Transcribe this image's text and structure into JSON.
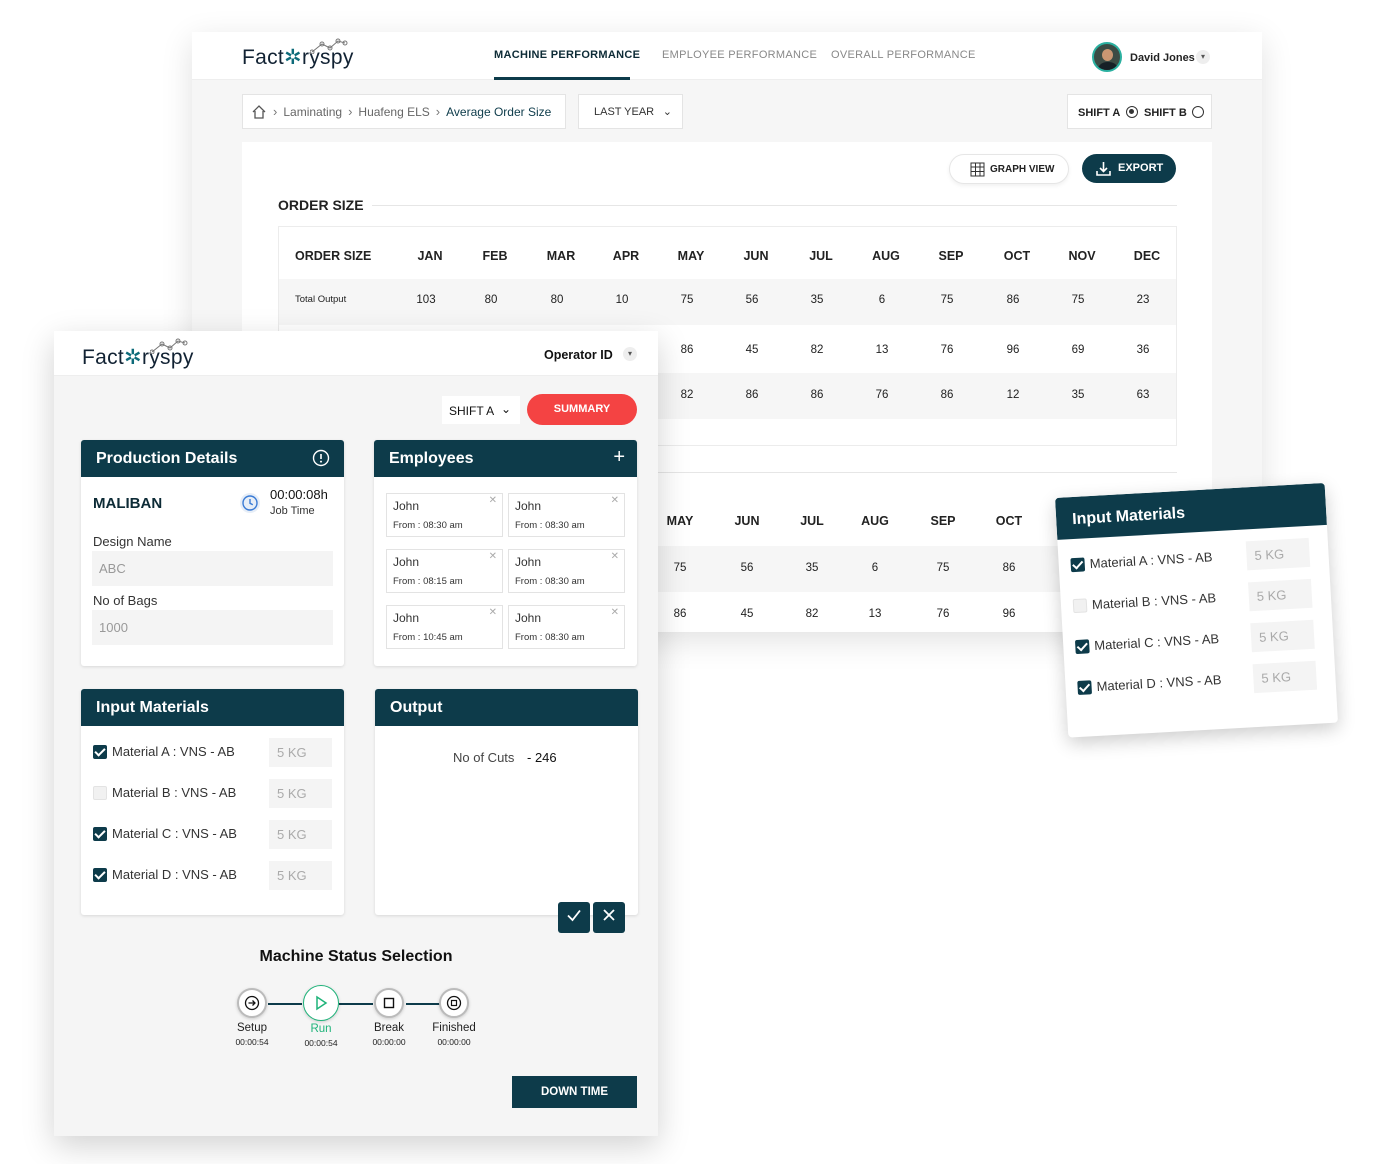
{
  "dashboard": {
    "logo": {
      "pre": "Fact",
      "mid": "ry",
      "post": "spy"
    },
    "nav": {
      "tabs": [
        "MACHINE PERFORMANCE",
        "EMPLOYEE PERFORMANCE",
        "OVERALL PERFORMANCE"
      ],
      "active_index": 0
    },
    "user": {
      "name": "David Jones"
    },
    "breadcrumb": [
      "Laminating",
      "Huafeng ELS",
      "Average Order Size"
    ],
    "period_select": "LAST YEAR",
    "shift": {
      "a": "SHIFT A",
      "b": "SHIFT B",
      "selected": "SHIFT A"
    },
    "buttons": {
      "graph_view": "GRAPH VIEW",
      "export": "EXPORT"
    },
    "section_title": "ORDER SIZE",
    "table": {
      "header_label": "ORDER SIZE",
      "months": [
        "JAN",
        "FEB",
        "MAR",
        "APR",
        "MAY",
        "JUN",
        "JUL",
        "AUG",
        "SEP",
        "OCT",
        "NOV",
        "DEC"
      ],
      "row_label": "Total Output",
      "row1": [
        "103",
        "80",
        "80",
        "10",
        "75",
        "56",
        "35",
        "6",
        "75",
        "86",
        "75",
        "23"
      ],
      "row2": [
        "86",
        "45",
        "82",
        "13",
        "76",
        "96",
        "69",
        "36"
      ],
      "row3": [
        "82",
        "86",
        "86",
        "76",
        "86",
        "12",
        "35",
        "63"
      ]
    },
    "table2": {
      "months": [
        "MAY",
        "JUN",
        "JUL",
        "AUG",
        "SEP",
        "OCT"
      ],
      "row1": [
        "75",
        "56",
        "35",
        "6",
        "75",
        "86"
      ],
      "row2": [
        "86",
        "45",
        "82",
        "13",
        "76",
        "96"
      ]
    }
  },
  "operator": {
    "logo": {
      "pre": "Fact",
      "mid": "ry",
      "post": "spy"
    },
    "operator_id_label": "Operator ID",
    "shift_select": "SHIFT A",
    "summary_button": "SUMMARY",
    "production": {
      "title": "Production Details",
      "job": "MALIBAN",
      "time": "00:00:08h",
      "time_label": "Job Time",
      "design_name_label": "Design Name",
      "design_name_value": "ABC",
      "bags_label": "No of Bags",
      "bags_value": "1000"
    },
    "employees": {
      "title": "Employees",
      "list": [
        {
          "name": "John",
          "from": "From : 08:30 am"
        },
        {
          "name": "John",
          "from": "From : 08:30 am"
        },
        {
          "name": "John",
          "from": "From : 08:15 am"
        },
        {
          "name": "John",
          "from": "From : 08:30 am"
        },
        {
          "name": "John",
          "from": "From : 10:45 am"
        },
        {
          "name": "John",
          "from": "From : 08:30 am"
        }
      ]
    },
    "input_materials": {
      "title": "Input Materials",
      "items": [
        {
          "label": "Material A :  VNS - AB",
          "qty": "5 KG",
          "checked": true
        },
        {
          "label": "Material B :  VNS - AB",
          "qty": "5 KG",
          "checked": false
        },
        {
          "label": "Material C :  VNS - AB",
          "qty": "5 KG",
          "checked": true
        },
        {
          "label": "Material D :  VNS - AB",
          "qty": "5 KG",
          "checked": true
        }
      ]
    },
    "output": {
      "title": "Output",
      "label": "No of Cuts",
      "value": "- 246"
    },
    "status": {
      "title": "Machine Status Selection",
      "steps": [
        {
          "label": "Setup",
          "time": "00:00:54"
        },
        {
          "label": "Run",
          "time": "00:00:54"
        },
        {
          "label": "Break",
          "time": "00:00:00"
        },
        {
          "label": "Finished",
          "time": "00:00:00"
        }
      ],
      "active": "Run"
    },
    "down_time_button": "DOWN TIME"
  },
  "floating_card": {
    "title": "Input Materials",
    "items": [
      {
        "label": "Material A :  VNS - AB",
        "qty": "5 KG",
        "checked": true
      },
      {
        "label": "Material B :  VNS - AB",
        "qty": "5 KG",
        "checked": false
      },
      {
        "label": "Material C :  VNS - AB",
        "qty": "5 KG",
        "checked": true
      },
      {
        "label": "Material D :  VNS - AB",
        "qty": "5 KG",
        "checked": true
      }
    ]
  },
  "colors": {
    "primary": "#0d3b4a",
    "accent_red": "#f44343",
    "run_green": "#1fb37a"
  }
}
